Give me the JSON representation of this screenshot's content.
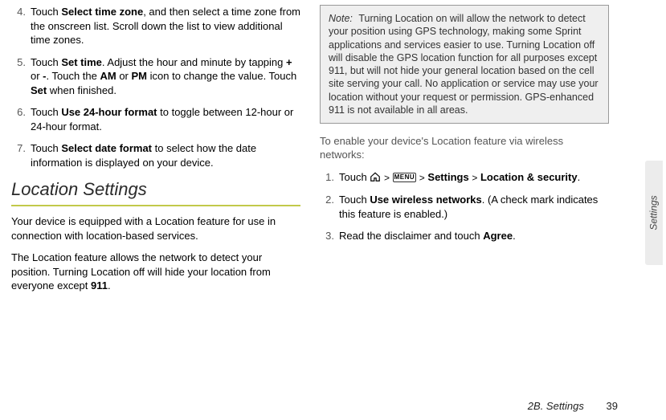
{
  "left": {
    "steps": [
      {
        "n": "4.",
        "pre": "Touch ",
        "bold1": "Select time zone",
        "post1": ", and then select a time zone from the onscreen list. Scroll down the list to view additional time zones."
      },
      {
        "n": "5.",
        "pre": "Touch ",
        "bold1": "Set time",
        "post1": ". Adjust the hour and minute by tapping ",
        "bold2": "+",
        "mid2": " or ",
        "bold3": "-",
        "post3": ". Touch the ",
        "bold4": "AM",
        "mid4": " or ",
        "bold5": "PM",
        "post5": " icon to change the value. Touch ",
        "bold6": "Set",
        "post6": " when finished."
      },
      {
        "n": "6.",
        "pre": "Touch ",
        "bold1": "Use 24-hour format",
        "post1": " to toggle between 12-hour or 24-hour format."
      },
      {
        "n": "7.",
        "pre": "Touch ",
        "bold1": "Select date format",
        "post1": " to select how the date information is displayed on your device."
      }
    ],
    "section_title": "Location Settings",
    "para1": "Your device is equipped with a Location feature for use in connection with location-based services.",
    "para2_a": "The Location feature allows the network to detect your position. Turning Location off will hide your location from everyone except ",
    "para2_bold": "911",
    "para2_b": "."
  },
  "right": {
    "note_label": "Note:",
    "note_text": "Turning Location on will allow the network to detect your position using GPS technology, making some Sprint applications and services easier to use. Turning Location off will disable the GPS location function for all purposes except 911, but will not hide your general location based on the cell site serving your call. No application or service may use your location without your request or permission. GPS-enhanced 911 is not available in all areas.",
    "subhead": "To enable your device's Location feature via wireless networks:",
    "steps": [
      {
        "n": "1.",
        "type": "nav",
        "pre": "Touch ",
        "gt": ">",
        "settings": "Settings",
        "locsec": "Location & security",
        "post": "."
      },
      {
        "n": "2.",
        "pre": "Touch ",
        "bold1": "Use wireless networks",
        "post1": ". (A check mark indicates this feature is enabled.)"
      },
      {
        "n": "3.",
        "pre": "Read the disclaimer and touch ",
        "bold1": "Agree",
        "post1": "."
      }
    ],
    "menu_label": "MENU"
  },
  "footer": {
    "section": "2B. Settings",
    "page": "39"
  },
  "side_tab": "Settings"
}
